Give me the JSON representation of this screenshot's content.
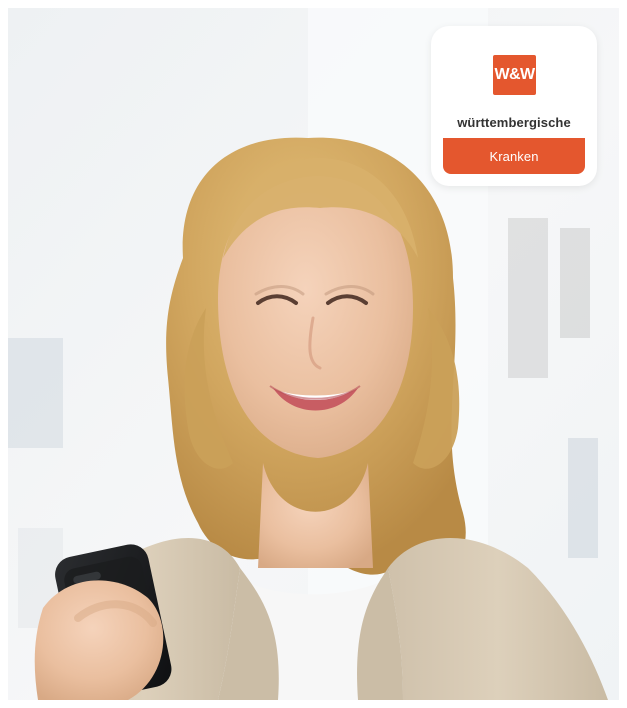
{
  "photo": {
    "subject": "woman-smiling-with-phone"
  },
  "logo": {
    "mark": "W&W",
    "brand": "württembergische",
    "band": "Kranken"
  },
  "colors": {
    "brand_orange": "#e4572e",
    "logo_text": "#333333",
    "hair": "#d8b06a",
    "blazer": "#d8cbb6",
    "skin": "#efc8ab"
  }
}
